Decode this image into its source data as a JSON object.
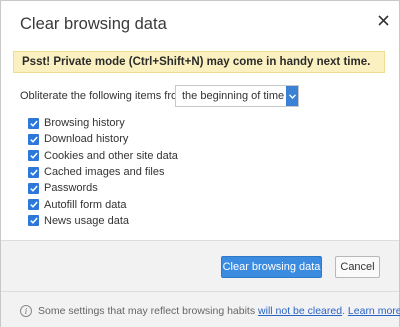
{
  "dialog": {
    "title": "Clear browsing data",
    "close_icon": "close-icon"
  },
  "notice": {
    "text": "Psst! Private mode (Ctrl+Shift+N) may come in handy next time."
  },
  "range": {
    "label": "Obliterate the following items from:",
    "selected": "the beginning of time"
  },
  "items": [
    {
      "label": "Browsing history",
      "checked": true
    },
    {
      "label": "Download history",
      "checked": true
    },
    {
      "label": "Cookies and other site data",
      "checked": true
    },
    {
      "label": "Cached images and files",
      "checked": true
    },
    {
      "label": "Passwords",
      "checked": true
    },
    {
      "label": "Autofill form data",
      "checked": true
    },
    {
      "label": "News usage data",
      "checked": true
    }
  ],
  "buttons": {
    "clear": "Clear browsing data",
    "cancel": "Cancel"
  },
  "footer": {
    "info_text": "Some settings that may reflect browsing habits",
    "link_not_cleared": "will not be cleared",
    "separator": ".",
    "link_learn_more": "Learn more"
  },
  "colors": {
    "accent": "#3b8be0",
    "notice_bg": "#fbf1c0",
    "checkbox": "#2b78d8",
    "link": "#2a63c6"
  }
}
